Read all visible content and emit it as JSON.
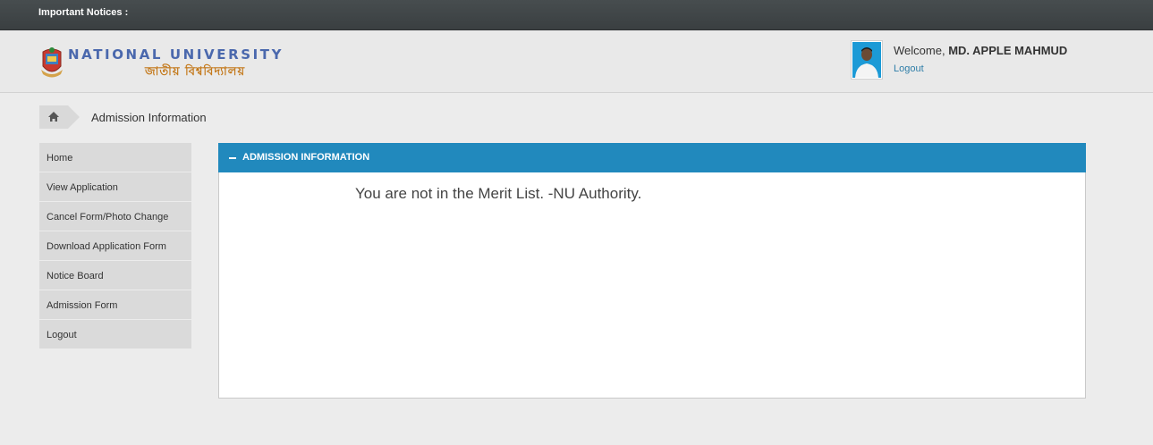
{
  "topbar": {
    "notice_label": "Important Notices :"
  },
  "header": {
    "logo_en": "NATIONAL UNIVERSITY",
    "logo_bn": "জাতীয় বিশ্ববিদ্যালয়",
    "welcome_prefix": "Welcome,",
    "user_name": "MD. APPLE MAHMUD",
    "logout_label": "Logout"
  },
  "breadcrumb": {
    "home_icon": "home-icon",
    "current": "Admission Information"
  },
  "sidebar": {
    "items": [
      {
        "label": "Home"
      },
      {
        "label": "View Application"
      },
      {
        "label": "Cancel Form/Photo Change"
      },
      {
        "label": "Download Application Form"
      },
      {
        "label": "Notice Board"
      },
      {
        "label": "Admission Form"
      },
      {
        "label": "Logout"
      }
    ]
  },
  "panel": {
    "title": "ADMISSION INFORMATION",
    "message": "You are not in the Merit List. -NU Authority."
  },
  "colors": {
    "panel_header": "#2189bd",
    "link": "#2f7ea8",
    "topbar": "#3f4446"
  }
}
